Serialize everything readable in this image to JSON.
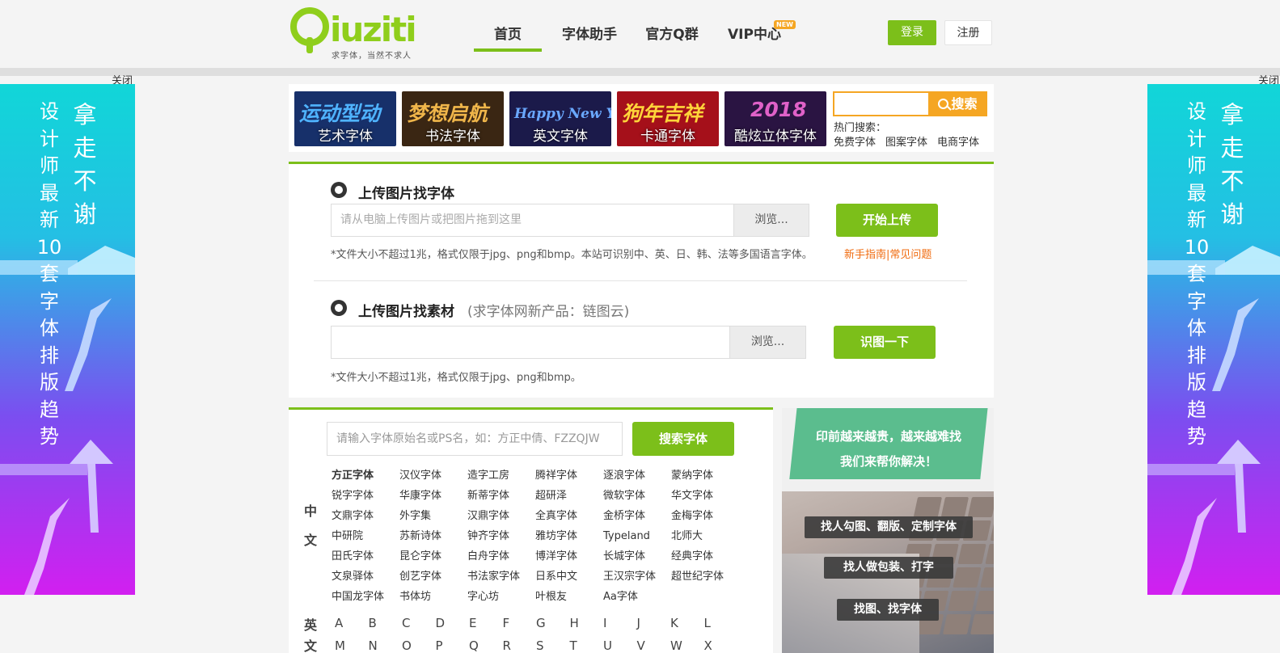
{
  "header": {
    "logo_text": "Qiuziti",
    "logo_tagline": "求字体，当然不求人",
    "nav": [
      {
        "label": "首页",
        "active": true
      },
      {
        "label": "字体助手"
      },
      {
        "label": "官方Q群"
      },
      {
        "label": "VIP中心",
        "badge": "NEW"
      }
    ],
    "login_label": "登录",
    "register_label": "注册"
  },
  "side_ads": {
    "close_label": "关闭",
    "col1": [
      "设",
      "计",
      "师",
      "最",
      "新",
      "10",
      "套",
      "字",
      "体",
      "排",
      "版",
      "趋",
      "势"
    ],
    "col2": [
      "拿",
      "走",
      "不",
      "谢"
    ]
  },
  "categories": [
    {
      "big_text": "运动型动",
      "label": "艺术字体",
      "bg": "#17306a",
      "fg": "#4fb3ff"
    },
    {
      "big_text": "梦想启航",
      "label": "书法字体",
      "bg": "#3a2613",
      "fg": "#f0b64a"
    },
    {
      "big_text": "Happy New Year",
      "label": "英文字体",
      "bg": "#1b1a4a",
      "fg": "#6aa8ff"
    },
    {
      "big_text": "狗年吉祥",
      "label": "卡通字体",
      "bg": "#a5101a",
      "fg": "#ffd43a"
    },
    {
      "big_text": "2018",
      "label": "酷炫立体字体",
      "bg": "#2a1442",
      "fg": "#e061c8"
    }
  ],
  "search": {
    "button_label": "搜索",
    "hot_label": "热门搜索：",
    "hot_links": [
      "免费字体",
      "图案字体",
      "电商字体"
    ]
  },
  "upload_font": {
    "title": "上传图片找字体",
    "placeholder": "请从电脑上传图片或把图片拖到这里",
    "browse_label": "浏览...",
    "upload_label": "开始上传",
    "note": "*文件大小不超过1兆，格式仅限于jpg、png和bmp。本站可识别中、英、日、韩、法等多国语言字体。",
    "help_links": [
      "新手指南",
      "常见问题"
    ]
  },
  "upload_material": {
    "title": "上传图片找素材",
    "subtitle": "(求字体网新产品：链图云)",
    "browse_label": "浏览...",
    "recognize_label": "识图一下",
    "note": "*文件大小不超过1兆，格式仅限于jpg、png和bmp。"
  },
  "font_search": {
    "placeholder": "请输入字体原始名或PS名，如：方正中倩、FZZQJW",
    "button_label": "搜索字体",
    "zh_label": "中文",
    "en_label": "英文",
    "fonts": [
      "方正字体",
      "汉仪字体",
      "造字工房",
      "腾祥字体",
      "逐浪字体",
      "蒙纳字体",
      "锐字字体",
      "华康字体",
      "新蒂字体",
      "超研泽",
      "微软字体",
      "华文字体",
      "文鼎字体",
      "外字集",
      "汉鼎字体",
      "全真字体",
      "金桥字体",
      "金梅字体",
      "中研院",
      "苏新诗体",
      "钟齐字体",
      "雅坊字体",
      "Typeland",
      "北师大",
      "田氏字体",
      "昆仑字体",
      "白舟字体",
      "博洋字体",
      "长城字体",
      "经典字体",
      "文泉驿体",
      "创艺字体",
      "书法家字体",
      "日系中文",
      "王汉宗字体",
      "超世纪字体",
      "中国龙字体",
      "书体坊",
      "字心坊",
      "叶根友",
      "Aa字体"
    ],
    "letters_row1": [
      "A",
      "B",
      "C",
      "D",
      "E",
      "F",
      "G",
      "H",
      "I",
      "J",
      "K",
      "L"
    ],
    "letters_row2": [
      "M",
      "N",
      "O",
      "P",
      "Q",
      "R",
      "S",
      "T",
      "U",
      "V",
      "W",
      "X"
    ]
  },
  "promo": {
    "headline_1": "印前越来越贵，越来越难找",
    "headline_2": "我们来帮你解决！",
    "pills": [
      "找人勾图、翻版、定制字体",
      "找人做包装、打字",
      "找图、找字体"
    ]
  },
  "colors": {
    "brand_green": "#7cbf1a",
    "search_orange": "#f5a623",
    "link_orange": "#f06b0f"
  }
}
